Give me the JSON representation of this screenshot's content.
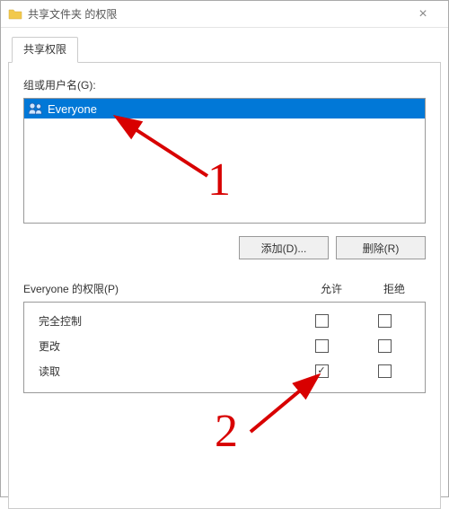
{
  "title": "共享文件夹 的权限",
  "tab_label": "共享权限",
  "groups_label": "组或用户名(G):",
  "user_entry": "Everyone",
  "add_button": "添加(D)...",
  "remove_button": "删除(R)",
  "permissions_for_label": "Everyone 的权限(P)",
  "col_allow": "允许",
  "col_deny": "拒绝",
  "perms": [
    {
      "name": "完全控制",
      "allow": false,
      "deny": false
    },
    {
      "name": "更改",
      "allow": false,
      "deny": false
    },
    {
      "name": "读取",
      "allow": true,
      "deny": false
    }
  ],
  "annotations": {
    "one": "1",
    "two": "2"
  }
}
